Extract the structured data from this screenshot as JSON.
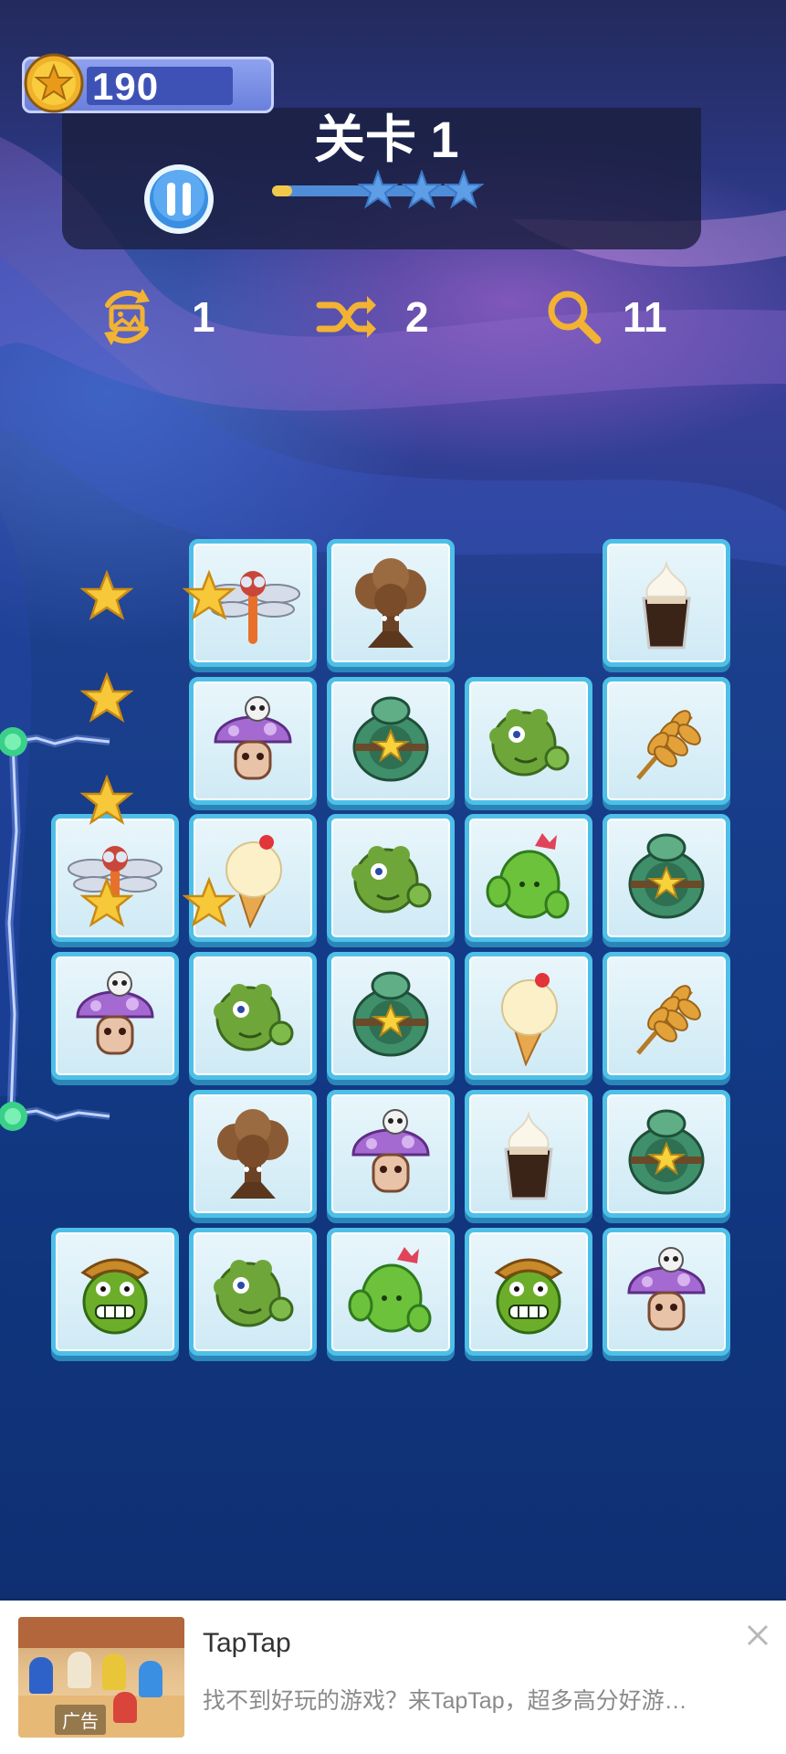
{
  "hud": {
    "coins": "190",
    "level_title": "关卡 1",
    "level_progress": 0.1,
    "progress_stars": 3
  },
  "tools": [
    {
      "name": "refresh-picture",
      "icon": "refresh-image-icon",
      "count": "1"
    },
    {
      "name": "shuffle",
      "icon": "shuffle-icon",
      "count": "2"
    },
    {
      "name": "hint",
      "icon": "magnifier-icon",
      "count": "11"
    }
  ],
  "board": {
    "rows": [
      [
        "empty",
        "dragonfly",
        "tree",
        "empty",
        "coffee"
      ],
      [
        "empty",
        "mushroom",
        "turtle",
        "green-monster",
        "wheat"
      ],
      [
        "dragonfly",
        "ice-cream",
        "green-monster",
        "cactus",
        "turtle"
      ],
      [
        "mushroom",
        "green-monster",
        "turtle",
        "ice-cream",
        "wheat"
      ],
      [
        "empty",
        "tree",
        "mushroom",
        "coffee",
        "turtle"
      ],
      [
        "cactus-monster",
        "green-monster",
        "cactus",
        "cactus-monster",
        "mushroom"
      ]
    ]
  },
  "colors": {
    "tile_border": "#4ec0e8",
    "tile_face": "#e9f6fb",
    "accent_gold": "#f2c84a",
    "hud_panel": "#191e3c"
  },
  "ad": {
    "title": "TapTap",
    "description": "找不到好玩的游戏？来TapTap，超多高分好游…",
    "tag": "广告"
  }
}
